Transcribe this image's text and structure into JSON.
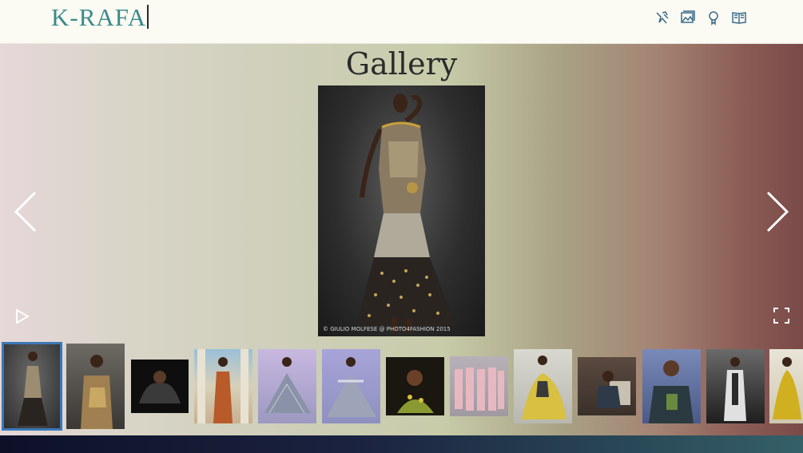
{
  "header": {
    "logo": "K-RAFA",
    "icons": [
      {
        "name": "fashion-icon",
        "color": "#3a6b8a"
      },
      {
        "name": "gallery-icon",
        "color": "#3a6b8a"
      },
      {
        "name": "award-icon",
        "color": "#3a6b8a"
      },
      {
        "name": "book-icon",
        "color": "#3a6b8a"
      }
    ]
  },
  "gallery": {
    "title": "Gallery",
    "main_photo_credit": "© GIULIO MOLFESE @ PHOTO4FASHION 2015",
    "controls": {
      "prev": "chevron-left-icon",
      "next": "chevron-right-icon",
      "play": "play-icon",
      "fullscreen": "fullscreen-icon"
    }
  },
  "thumbnails": [
    {
      "name": "thumb-1",
      "active": true
    },
    {
      "name": "thumb-2",
      "active": false
    },
    {
      "name": "thumb-3",
      "active": false
    },
    {
      "name": "thumb-4",
      "active": false
    },
    {
      "name": "thumb-5",
      "active": false
    },
    {
      "name": "thumb-6",
      "active": false
    },
    {
      "name": "thumb-7",
      "active": false
    },
    {
      "name": "thumb-8",
      "active": false
    },
    {
      "name": "thumb-9",
      "active": false
    },
    {
      "name": "thumb-10",
      "active": false
    },
    {
      "name": "thumb-11",
      "active": false
    },
    {
      "name": "thumb-12",
      "active": false
    },
    {
      "name": "thumb-13",
      "active": false
    }
  ],
  "colors": {
    "logo": "#3a8a8c",
    "active_border": "#3b78b8"
  }
}
